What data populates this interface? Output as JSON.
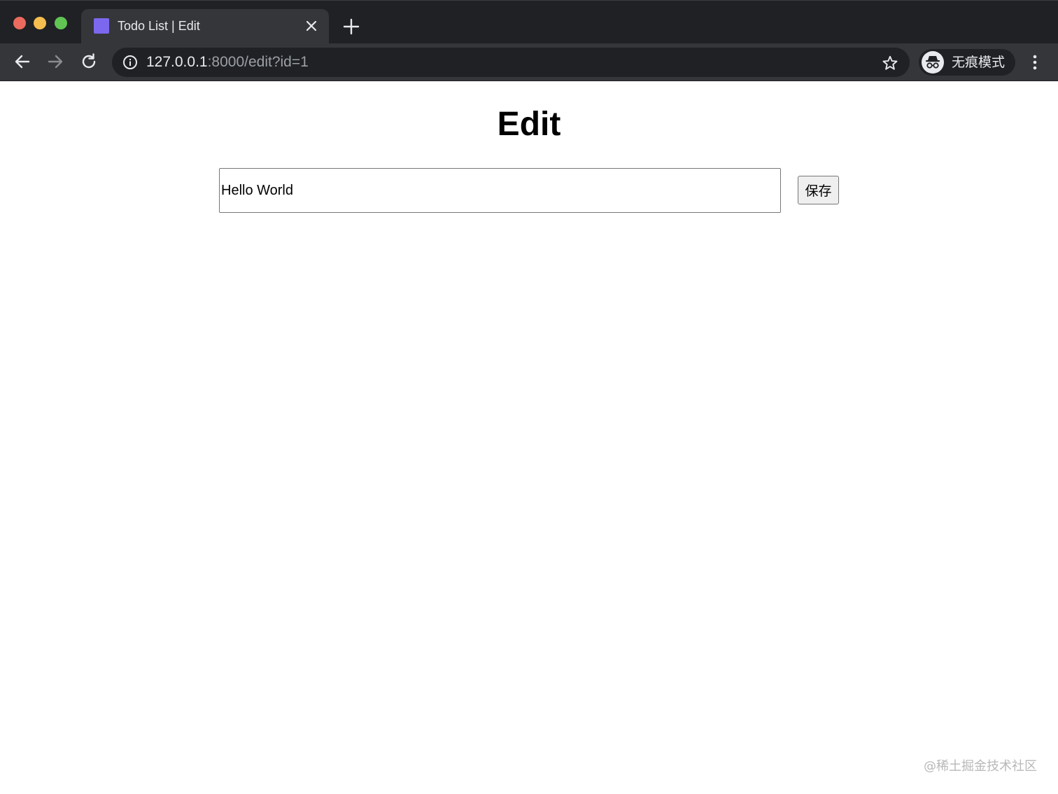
{
  "browser": {
    "tab": {
      "title": "Todo List | Edit",
      "favicon": "square-favicon",
      "favicon_color": "#7b68ee"
    },
    "address_bar": {
      "host": "127.0.0.1",
      "path": ":8000/edit?id=1"
    },
    "profile": {
      "label": "无痕模式",
      "icon": "incognito-icon"
    },
    "icons": [
      "back-arrow-icon",
      "forward-arrow-icon",
      "reload-icon",
      "info-icon",
      "star-icon",
      "menu-icon",
      "close-icon",
      "plus-icon"
    ]
  },
  "page": {
    "title": "Edit",
    "todo_input_value": "Hello World",
    "save_label": "保存"
  },
  "watermark": "@稀土掘金技术社区",
  "colors": {
    "tabstrip_bg": "#202124",
    "toolbar_bg": "#35363a",
    "traffic_red": "#ed6a5e",
    "traffic_yellow": "#f5bf4f",
    "traffic_green": "#61c554"
  }
}
